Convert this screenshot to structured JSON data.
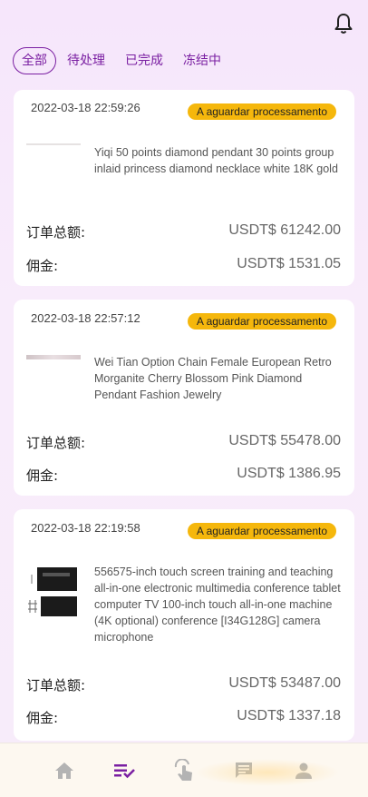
{
  "tabs": [
    {
      "label": "全部",
      "active": true
    },
    {
      "label": "待处理",
      "active": false
    },
    {
      "label": "已完成",
      "active": false
    },
    {
      "label": "冻结中",
      "active": false
    }
  ],
  "orders": [
    {
      "time": "2022-03-18 22:59:26",
      "status": "A aguardar processamento",
      "title": "Yiqi 50 points diamond pendant 30 points group inlaid princess diamond necklace white 18K gold",
      "total_label": "订单总额:",
      "total_value": "USDT$ 61242.00",
      "commission_label": "佣金:",
      "commission_value": "USDT$ 1531.05"
    },
    {
      "time": "2022-03-18 22:57:12",
      "status": "A aguardar processamento",
      "title": "Wei Tian Option Chain Female European Retro Morganite Cherry Blossom Pink Diamond Pendant Fashion Jewelry",
      "total_label": "订单总额:",
      "total_value": "USDT$ 55478.00",
      "commission_label": "佣金:",
      "commission_value": "USDT$ 1386.95"
    },
    {
      "time": "2022-03-18 22:19:58",
      "status": "A aguardar processamento",
      "title": "556575-inch touch screen training and teaching all-in-one electronic multimedia conference tablet computer TV 100-inch touch all-in-one machine (4K optional) conference [I34G128G] camera microphone",
      "total_label": "订单总额:",
      "total_value": "USDT$ 53487.00",
      "commission_label": "佣金:",
      "commission_value": "USDT$ 1337.18"
    }
  ],
  "nav": [
    {
      "icon": "home-icon",
      "active": false
    },
    {
      "icon": "orders-list-icon",
      "active": true
    },
    {
      "icon": "tap-hand-icon",
      "active": false
    },
    {
      "icon": "chat-icon",
      "active": false
    },
    {
      "icon": "user-icon",
      "active": false
    }
  ],
  "colors": {
    "accent": "#7a1fa2",
    "badge": "#f5b70c",
    "nav_inactive": "#b3b3b3"
  }
}
